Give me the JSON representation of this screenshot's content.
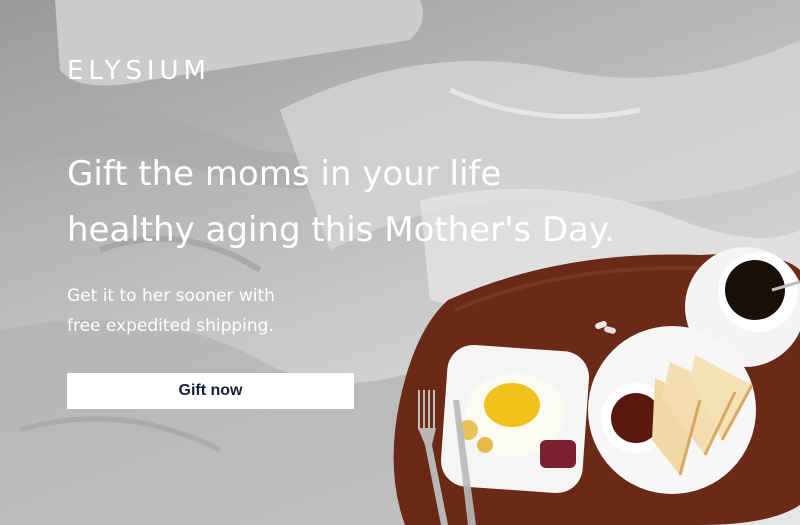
{
  "brand": {
    "logo_text": "ELYSIUM"
  },
  "hero": {
    "headline_line1": "Gift the moms in your life",
    "headline_line2": "healthy aging this Mother's Day.",
    "subtext_line1": "Get it to her sooner with",
    "subtext_line2": "free expedited shipping.",
    "cta_label": "Gift now"
  },
  "colors": {
    "text": "#ffffff",
    "cta_background": "#ffffff",
    "cta_text": "#15203a",
    "tray": "#6b2a18"
  },
  "image": {
    "subject": "breakfast tray on bed",
    "items": [
      "wooden-tray",
      "coffee-cup",
      "egg-plate",
      "toast-plate",
      "jam-bowl",
      "fork",
      "supplement-capsules"
    ]
  }
}
